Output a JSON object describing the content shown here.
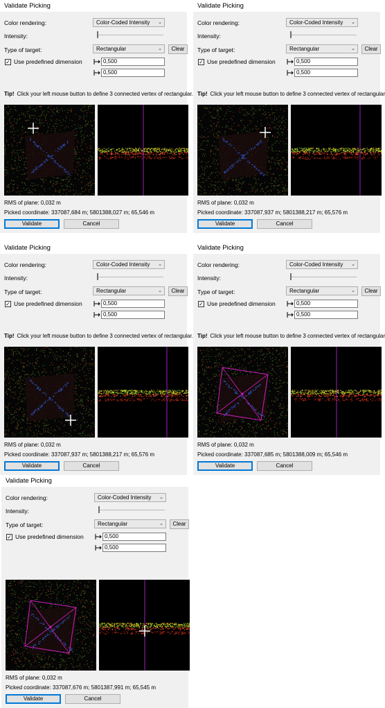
{
  "panels": [
    {
      "title": "Validate Picking",
      "color_rendering_label": "Color rendering:",
      "color_rendering_value": "Color-Coded Intensity",
      "intensity_label": "Intensity:",
      "intensity_level": 0.0,
      "target_label": "Type of target:",
      "target_value": "Rectangular",
      "clear_label": "Clear",
      "use_dimension_label": "Use predefined dimension",
      "use_dimension_checked": "✓",
      "dim1": "0,500",
      "dim2": "0,500",
      "tip_title": "Tip!",
      "tip_text": "Click your left mouse button to define 3 connected vertex of rectangular.",
      "rms": "RMS of plane: 0,032 m",
      "picked": "Picked coordinate: 337087,684 m; 5801388,027 m; 65,546 m",
      "validate_label": "Validate",
      "cancel_label": "Cancel"
    },
    {
      "title": "Validate Picking",
      "color_rendering_label": "Color rendering:",
      "color_rendering_value": "Color-Coded Intensity",
      "intensity_label": "Intensity:",
      "intensity_level": 0.0,
      "target_label": "Type of target:",
      "target_value": "Rectangular",
      "clear_label": "Clear",
      "use_dimension_label": "Use predefined dimension",
      "use_dimension_checked": "✓",
      "dim1": "0,500",
      "dim2": "0,500",
      "tip_title": "Tip!",
      "tip_text": "Click your left mouse button to define 3 connected vertex of rectangular.",
      "rms": "RMS of plane: 0,032 m",
      "picked": "Picked coordinate: 337087,937 m; 5801388,217 m; 65,576 m",
      "validate_label": "Validate",
      "cancel_label": "Cancel"
    },
    {
      "title": "Validate Picking",
      "color_rendering_label": "Color rendering:",
      "color_rendering_value": "Color-Coded Intensity",
      "intensity_label": "Intensity:",
      "intensity_level": 0.0,
      "target_label": "Type of target:",
      "target_value": "Rectangular",
      "clear_label": "Clear",
      "use_dimension_label": "Use predefined dimension",
      "use_dimension_checked": "✓",
      "dim1": "0,500",
      "dim2": "0,500",
      "tip_title": "Tip!",
      "tip_text": "Click your left mouse button to define 3 connected vertex of rectangular.",
      "rms": "RMS of plane: 0,032 m",
      "picked": "Picked coordinate: 337087,937 m; 5801388,217 m; 65,576 m",
      "validate_label": "Validate",
      "cancel_label": "Cancel"
    },
    {
      "title": "Validate Picking",
      "color_rendering_label": "Color rendering:",
      "color_rendering_value": "Color-Coded Intensity",
      "intensity_label": "Intensity:",
      "intensity_level": 0.0,
      "target_label": "Type of target:",
      "target_value": "Rectangular",
      "clear_label": "Clear",
      "use_dimension_label": "Use predefined dimension",
      "use_dimension_checked": "✓",
      "dim1": "0,500",
      "dim2": "0,500",
      "tip_title": "Tip!",
      "tip_text": "Click your left mouse button to define 3 connected vertex of rectangular.",
      "rms": "RMS of plane: 0,032 m",
      "picked": "Picked coordinate: 337087,685 m; 5801388,009 m; 65,546 m",
      "validate_label": "Validate",
      "cancel_label": "Cancel"
    },
    {
      "title": "Validate Picking",
      "color_rendering_label": "Color rendering:",
      "color_rendering_value": "Color-Coded Intensity",
      "intensity_label": "Intensity:",
      "intensity_level": 0.0,
      "target_label": "Type of target:",
      "target_value": "Rectangular",
      "clear_label": "Clear",
      "use_dimension_label": "Use predefined dimension",
      "use_dimension_checked": "✓",
      "dim1": "0,500",
      "dim2": "0,500",
      "tip_title": "",
      "tip_text": "",
      "rms": "RMS of plane: 0,032 m",
      "picked": "Picked coordinate: 337087,676 m; 5801387,991 m; 65,545 m",
      "validate_label": "Validate",
      "cancel_label": "Cancel"
    }
  ],
  "colors": {
    "panel_bg": "#f0f0f0",
    "accent": "#0078d7",
    "rectangle_overlay": "#d020c0",
    "profile_line": "#a020c0"
  }
}
